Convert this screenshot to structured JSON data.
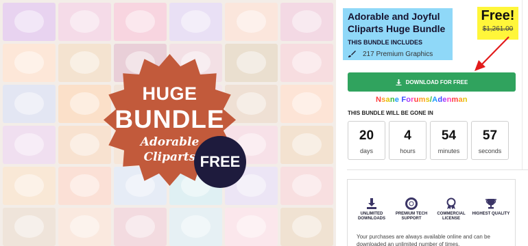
{
  "hero": {
    "badge_line1": "HUGE",
    "badge_line2": "BUNDLE",
    "badge_line3": "Adorable",
    "badge_line4": "Cliparts",
    "free_circle": "FREE",
    "burst_color": "#c25a3b",
    "tile_colors": [
      "#e8d3f0",
      "#f5dbe8",
      "#f8d5e0",
      "#e9e0f5",
      "#fbe6dc",
      "#f3d9e4",
      "#fde7d8",
      "#f4e3d0",
      "#e9cfd8",
      "#f3e0e5",
      "#eadfcf",
      "#f7dde0",
      "#e3e6f3",
      "#fbe0c9",
      "#f1e4da",
      "#f4e6ea",
      "#efe0d4",
      "#fde4d6",
      "#f0dff0",
      "#f8e2d0",
      "#f6e6d8",
      "#e2ecf5",
      "#f7e1e8",
      "#f3e2d0",
      "#f9e8d6",
      "#fbe0d6",
      "#e6ecf6",
      "#dff0f3",
      "#ece5f5",
      "#f8dfe0",
      "#efe4da",
      "#fae9df",
      "#f3dbe0",
      "#e6f0f4",
      "#fbe7ec",
      "#f0e2d2"
    ]
  },
  "product": {
    "title": "Adorable and Joyful Cliparts Huge Bundle",
    "includes_label": "THIS BUNDLE INCLUDES",
    "graphics_count": "217 Premium Graphics",
    "title_bg": "#8fd8f8"
  },
  "price": {
    "free_label": "Free!",
    "old_price": "$1,261.00",
    "highlight": "#fff63a"
  },
  "download": {
    "label": "DOWNLOAD FOR FREE",
    "color": "#30a35e"
  },
  "watermark": {
    "text": "Nsane Forums/Adenman"
  },
  "countdown": {
    "heading": "THIS BUNDLE WILL BE GONE IN",
    "units": [
      {
        "value": "20",
        "label": "days"
      },
      {
        "value": "4",
        "label": "hours"
      },
      {
        "value": "54",
        "label": "minutes"
      },
      {
        "value": "57",
        "label": "seconds"
      }
    ]
  },
  "features": {
    "items": [
      {
        "label": "UNLIMITED DOWNLOADS",
        "icon": "download-icon"
      },
      {
        "label": "PREMIUM TECH SUPPORT",
        "icon": "lifebuoy-icon"
      },
      {
        "label": "COMMERCIAL LICENSE",
        "icon": "ribbon-icon"
      },
      {
        "label": "HIGHEST QUALITY",
        "icon": "trophy-icon"
      }
    ],
    "promise": "Your purchases are always available online and can be downloaded an unlimited number of times."
  }
}
